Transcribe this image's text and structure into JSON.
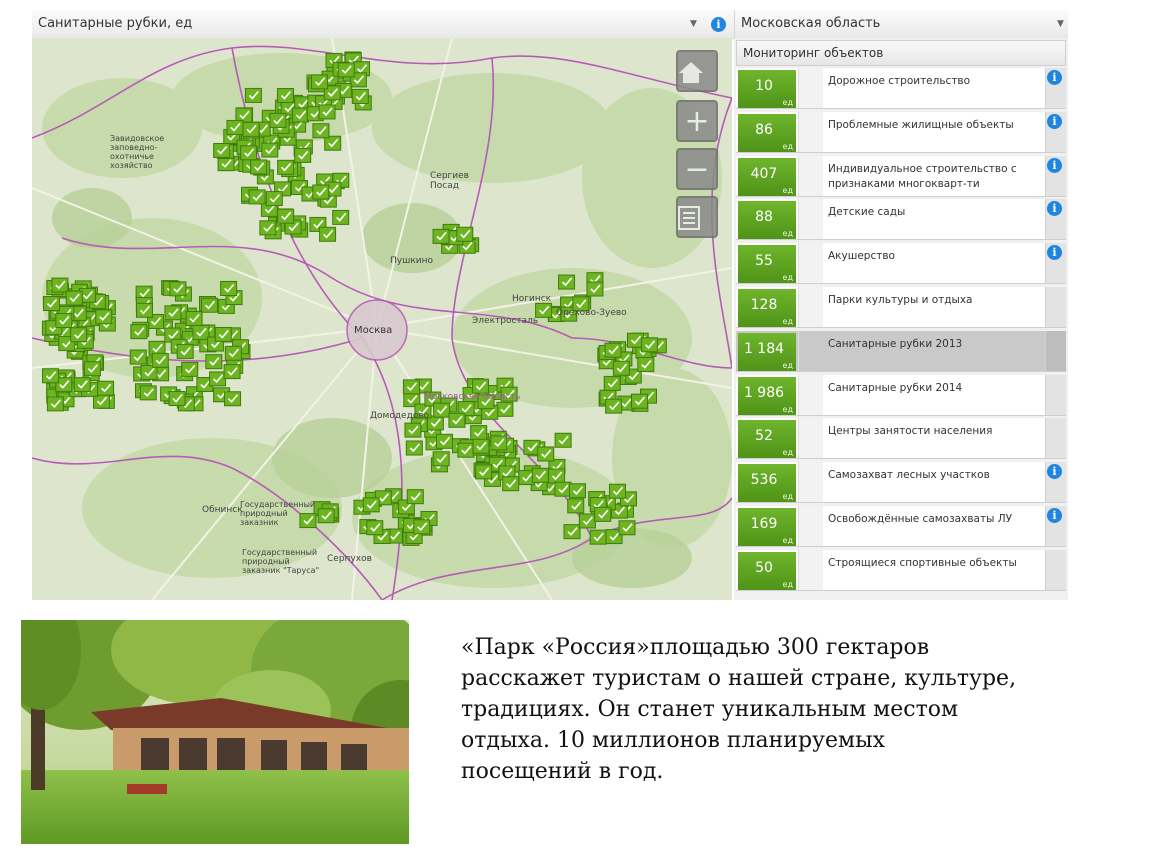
{
  "layer_select": {
    "value": "Санитарные рубки, ед"
  },
  "region_select": {
    "value": "Московская область"
  },
  "map": {
    "cities": [
      "Москва",
      "Сергиев Посад",
      "Пушкино",
      "Ногинск",
      "Электросталь",
      "Орехово-Зуево",
      "Домодедово",
      "Серпухов",
      "Обнинск",
      "Московская область"
    ],
    "controls": [
      "home-icon",
      "zoom-in-icon",
      "zoom-out-icon",
      "list-icon"
    ],
    "reserve_labels": [
      "Завидовское заповедно-охотничье хозяйство",
      "Государственный природный заказник",
      "Государственный природный заказник \"Таруса\""
    ]
  },
  "panel": {
    "header": "Мониторинг объектов",
    "unit": "ед",
    "items": [
      {
        "value": "10",
        "label": "Дорожное строительство",
        "info": true,
        "selected": false
      },
      {
        "value": "86",
        "label": "Проблемные жилищные объекты",
        "info": true,
        "selected": false
      },
      {
        "value": "407",
        "label": "Индивидуальное строительство с признаками многокварт-ти",
        "info": true,
        "selected": false
      },
      {
        "value": "88",
        "label": "Детские сады",
        "info": true,
        "selected": false
      },
      {
        "value": "55",
        "label": "Акушерство",
        "info": true,
        "selected": false
      },
      {
        "value": "128",
        "label": "Парки культуры и отдыха",
        "info": false,
        "selected": false
      },
      {
        "value": "1 184",
        "label": "Санитарные рубки 2013",
        "info": false,
        "selected": true
      },
      {
        "value": "1 986",
        "label": "Санитарные рубки 2014",
        "info": false,
        "selected": false
      },
      {
        "value": "52",
        "label": "Центры занятости населения",
        "info": false,
        "selected": false
      },
      {
        "value": "536",
        "label": "Самозахват лесных участков",
        "info": true,
        "selected": false
      },
      {
        "value": "169",
        "label": "Освобождённые самозахваты ЛУ",
        "info": true,
        "selected": false
      },
      {
        "value": "50",
        "label": "Строящиеся спортивные объекты",
        "info": false,
        "selected": false
      }
    ]
  },
  "caption": "«Парк  «Россия»площадью 300 гектаров расскажет туристам о нашей стране, культуре, традициях. Он станет уникальным местом отдыха. 10 миллионов планируемых посещений в год."
}
